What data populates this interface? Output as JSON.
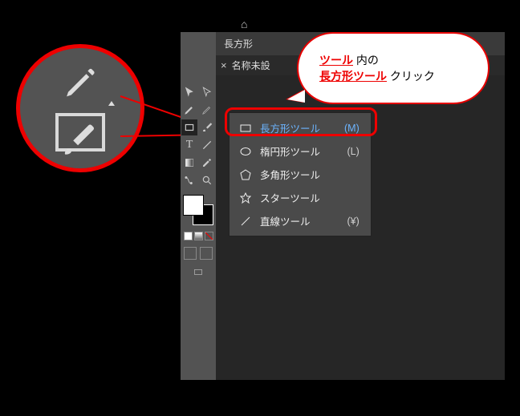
{
  "panel": {
    "title": "長方形"
  },
  "tabbar": {
    "close": "×",
    "tab_label": "名称未設"
  },
  "flyout": {
    "items": [
      {
        "label": "長方形ツール",
        "shortcut": "(M)",
        "selected": true
      },
      {
        "label": "楕円形ツール",
        "shortcut": "(L)",
        "selected": false
      },
      {
        "label": "多角形ツール",
        "shortcut": "",
        "selected": false
      },
      {
        "label": "スターツール",
        "shortcut": "",
        "selected": false
      },
      {
        "label": "直線ツール",
        "shortcut": "(¥)",
        "selected": false
      }
    ]
  },
  "callout": {
    "line1_accent": "ツール",
    "line1_rest": " 内の",
    "line2_accent": "長方形ツール",
    "line2_rest": " クリック"
  },
  "icons": {
    "home": "⌂",
    "pen": "pen-icon",
    "rect": "rectangle-icon",
    "brush": "brush-icon",
    "ellipse": "ellipse-icon",
    "polygon": "polygon-icon",
    "star": "star-icon",
    "line": "line-icon"
  }
}
